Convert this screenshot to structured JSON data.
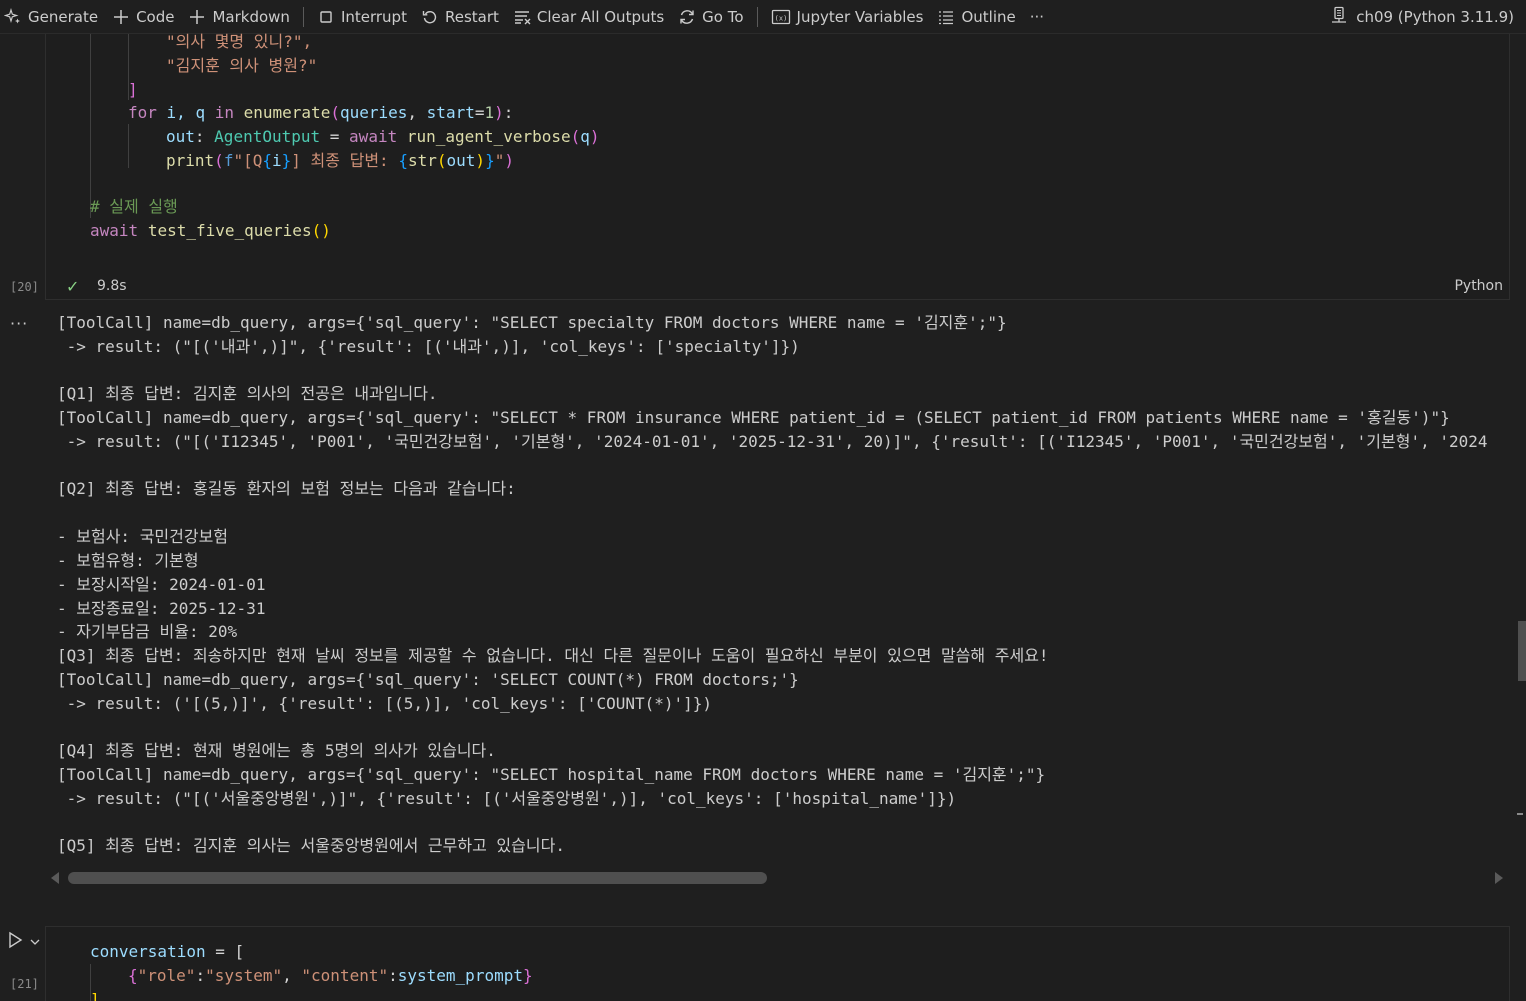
{
  "toolbar": {
    "generate": "Generate",
    "code": "Code",
    "markdown": "Markdown",
    "interrupt": "Interrupt",
    "restart": "Restart",
    "clear_all_outputs": "Clear All Outputs",
    "go_to": "Go To",
    "jupyter_variables": "Jupyter Variables",
    "outline": "Outline",
    "more": "···",
    "kernel": "ch09 (Python 3.11.9)"
  },
  "cell20": {
    "execution_count": "[20]",
    "exec_time": "9.8s",
    "language": "Python",
    "code": {
      "l1": "\"의사 몇명 있니?\",",
      "l2": "\"김지훈 의사 병원?\"",
      "l3": "]",
      "l4_kw": "for",
      "l4_vars": "i, q",
      "l4_in": "in",
      "l4_fn": "enumerate",
      "l4_arg1": "queries",
      "l4_arg2": "start",
      "l4_num": "1",
      "l5_var": "out",
      "l5_cls": "AgentOutput",
      "l5_await": "await",
      "l5_fn": "run_agent_verbose",
      "l5_arg": "q",
      "l6_fn": "print",
      "l6_f": "f",
      "l6_s1": "\"[Q",
      "l6_i": "i",
      "l6_s2": "] 최종 답변: ",
      "l6_str": "str",
      "l6_out": "out",
      "l6_s3": "\"",
      "l8": "# 실제 실행",
      "l9_await": "await",
      "l9_fn": "test_five_queries"
    },
    "output_lines": [
      "[ToolCall] name=db_query, args={'sql_query': \"SELECT specialty FROM doctors WHERE name = '김지훈';\"}",
      " -> result: (\"[('내과',)]\", {'result': [('내과',)], 'col_keys': ['specialty']})",
      "",
      "[Q1] 최종 답변: 김지훈 의사의 전공은 내과입니다.",
      "[ToolCall] name=db_query, args={'sql_query': \"SELECT * FROM insurance WHERE patient_id = (SELECT patient_id FROM patients WHERE name = '홍길동')\"}",
      " -> result: (\"[('I12345', 'P001', '국민건강보험', '기본형', '2024-01-01', '2025-12-31', 20)]\", {'result': [('I12345', 'P001', '국민건강보험', '기본형', '2024",
      "",
      "[Q2] 최종 답변: 홍길동 환자의 보험 정보는 다음과 같습니다:",
      "",
      "- 보험사: 국민건강보험",
      "- 보험유형: 기본형",
      "- 보장시작일: 2024-01-01",
      "- 보장종료일: 2025-12-31",
      "- 자기부담금 비율: 20%",
      "[Q3] 최종 답변: 죄송하지만 현재 날씨 정보를 제공할 수 없습니다. 대신 다른 질문이나 도움이 필요하신 부분이 있으면 말씀해 주세요!",
      "[ToolCall] name=db_query, args={'sql_query': 'SELECT COUNT(*) FROM doctors;'}",
      " -> result: ('[(5,)]', {'result': [(5,)], 'col_keys': ['COUNT(*)']})",
      "",
      "[Q4] 최종 답변: 현재 병원에는 총 5명의 의사가 있습니다.",
      "[ToolCall] name=db_query, args={'sql_query': \"SELECT hospital_name FROM doctors WHERE name = '김지훈';\"}",
      " -> result: (\"[('서울중앙병원',)]\", {'result': [('서울중앙병원',)], 'col_keys': ['hospital_name']})",
      "",
      "[Q5] 최종 답변: 김지훈 의사는 서울중앙병원에서 근무하고 있습니다."
    ]
  },
  "cell21": {
    "execution_count": "[21]",
    "code": {
      "l1_var": "conversation",
      "l1_rest": " = [",
      "l2_k1": "\"role\"",
      "l2_v1": "\"system\"",
      "l2_k2": "\"content\"",
      "l2_v2": "system_prompt",
      "l3": "]"
    }
  }
}
